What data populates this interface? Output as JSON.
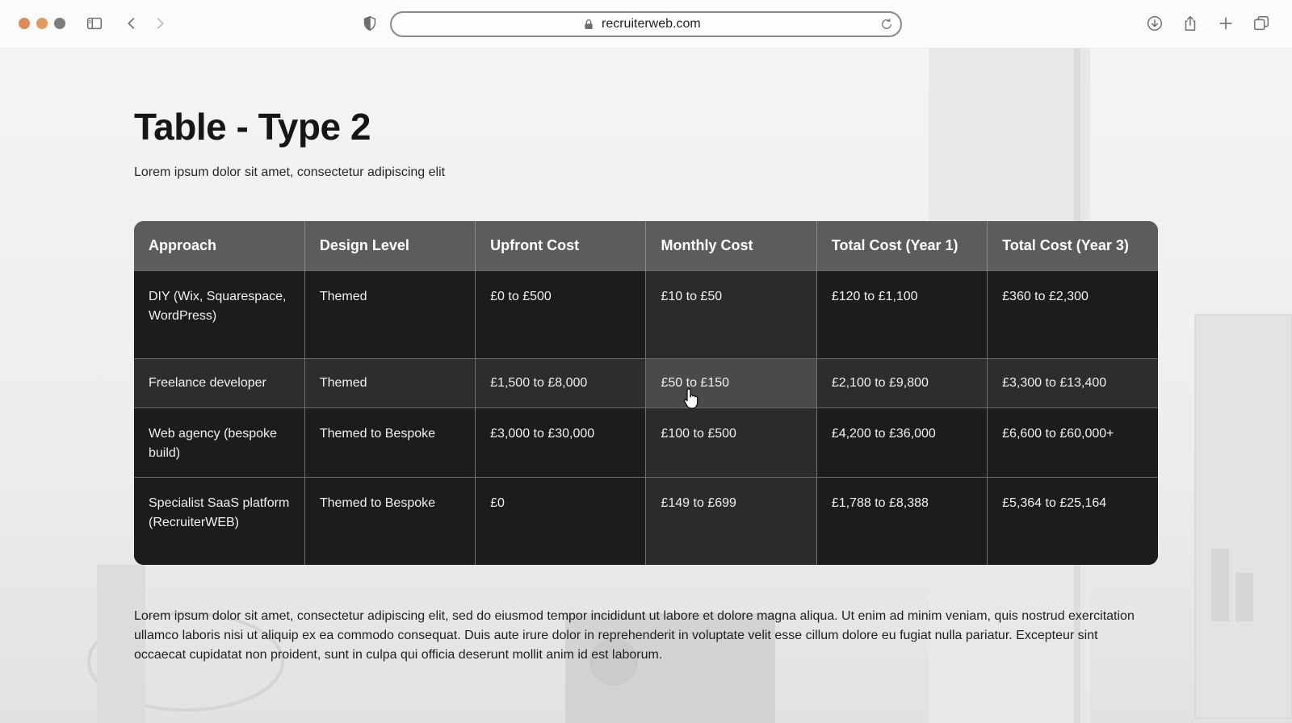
{
  "browser": {
    "url": "recruiterweb.com",
    "icons": [
      "sidebar-icon",
      "back-icon",
      "forward-icon",
      "shield-icon",
      "lock-icon",
      "reload-icon",
      "download-icon",
      "share-icon",
      "new-tab-icon",
      "tabs-overview-icon"
    ]
  },
  "page": {
    "title": "Table - Type 2",
    "subtitle": "Lorem ipsum dolor sit amet, consectetur adipiscing elit",
    "body": "Lorem ipsum dolor sit amet, consectetur adipiscing elit, sed do eiusmod tempor incididunt ut labore et dolore magna aliqua. Ut enim ad minim veniam, quis nostrud exercitation ullamco laboris nisi ut aliquip ex ea commodo consequat. Duis aute irure dolor in reprehenderit in voluptate velit esse cillum dolore eu fugiat nulla pariatur. Excepteur sint occaecat cupidatat non proident, sunt in culpa qui officia deserunt mollit anim id est laborum."
  },
  "table": {
    "headers": [
      "Approach",
      "Design Level",
      "Upfront Cost",
      "Monthly Cost",
      "Total Cost (Year 1)",
      "Total Cost (Year 3)"
    ],
    "rows": [
      [
        "DIY (Wix, Squarespace, WordPress)",
        "Themed",
        "£0 to £500",
        "£10 to £50",
        "£120 to £1,100",
        "£360 to £2,300"
      ],
      [
        "Freelance developer",
        "Themed",
        "£1,500 to £8,000",
        "£50 to £150",
        "£2,100 to £9,800",
        "£3,300 to £13,400"
      ],
      [
        "Web agency (bespoke build)",
        "Themed to Bespoke",
        "£3,000 to £30,000",
        "£100 to £500",
        "£4,200 to £36,000",
        "£6,600 to £60,000+"
      ],
      [
        "Specialist SaaS platform (RecruiterWEB)",
        "Themed to Bespoke",
        "£0",
        "£149 to £699",
        "£1,788 to £8,388",
        "£5,364 to £25,164"
      ]
    ]
  },
  "colors": {
    "header_bg": "#5c5c5c",
    "row_bg": "#1c1c1c",
    "highlight_bg": "#4a4a4a"
  }
}
